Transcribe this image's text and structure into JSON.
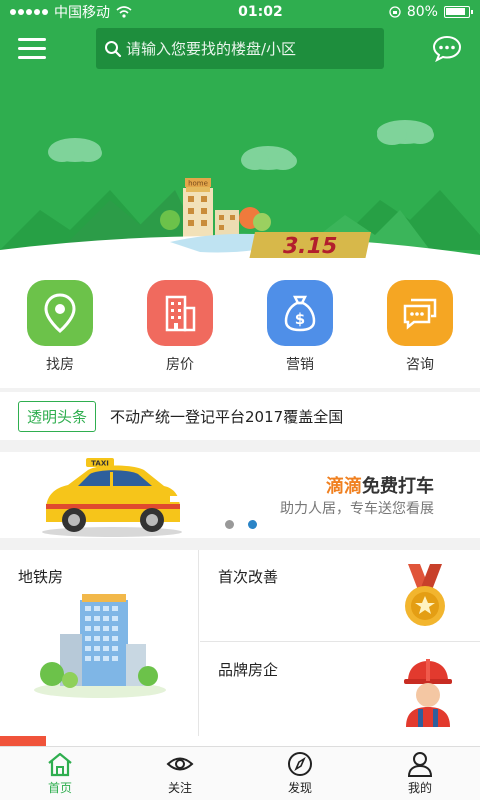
{
  "status_bar": {
    "carrier": "中国移动",
    "time": "01:02",
    "battery": "80%"
  },
  "search": {
    "placeholder": "请输入您要找的楼盘/小区"
  },
  "hero": {
    "home_sign": "home",
    "promo": "3.15"
  },
  "quick_links": [
    {
      "label": "找房",
      "icon": "location-pin-icon",
      "color": "#6cc24a"
    },
    {
      "label": "房价",
      "icon": "building-icon",
      "color": "#f06a5e"
    },
    {
      "label": "营销",
      "icon": "money-bag-icon",
      "color": "#4f8fe8"
    },
    {
      "label": "咨询",
      "icon": "chat-bubbles-icon",
      "color": "#f5a623"
    }
  ],
  "headline": {
    "tag": "透明头条",
    "text": "不动产统一登记平台2017覆盖全国"
  },
  "banner": {
    "title_highlight": "滴滴",
    "title_rest": "免费打车",
    "subtitle": "助力人居，专车送您看展",
    "taxi_sign": "TAXI",
    "pages": 2,
    "active_page": 2
  },
  "features": [
    {
      "label": "地铁房",
      "icon": "building-illustration-icon"
    },
    {
      "label": "首次改善",
      "icon": "medal-icon"
    },
    {
      "label": "品牌房企",
      "icon": "worker-icon"
    }
  ],
  "tabs": [
    {
      "label": "首页",
      "icon": "home-icon",
      "active": true
    },
    {
      "label": "关注",
      "icon": "eye-icon",
      "active": false
    },
    {
      "label": "发现",
      "icon": "compass-icon",
      "active": false
    },
    {
      "label": "我的",
      "icon": "person-icon",
      "active": false
    }
  ],
  "colors": {
    "brand_green": "#2fae4f",
    "search_bg": "#1e8e3d",
    "accent_orange": "#f08020",
    "pager_active": "#2b84c6"
  }
}
